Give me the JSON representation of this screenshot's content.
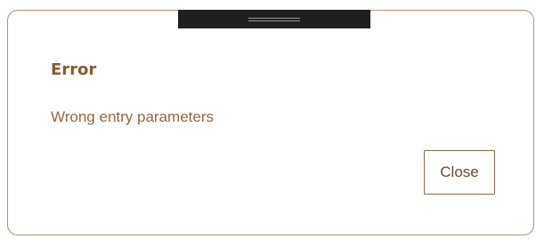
{
  "dialog": {
    "title": "Error",
    "message": "Wrong entry parameters",
    "close_label": "Close"
  },
  "colors": {
    "accent": "#8a5a2b",
    "border": "#b89070",
    "handle": "#1f1f1f"
  },
  "icons": {
    "drag_handle": "grip-lines-icon"
  }
}
